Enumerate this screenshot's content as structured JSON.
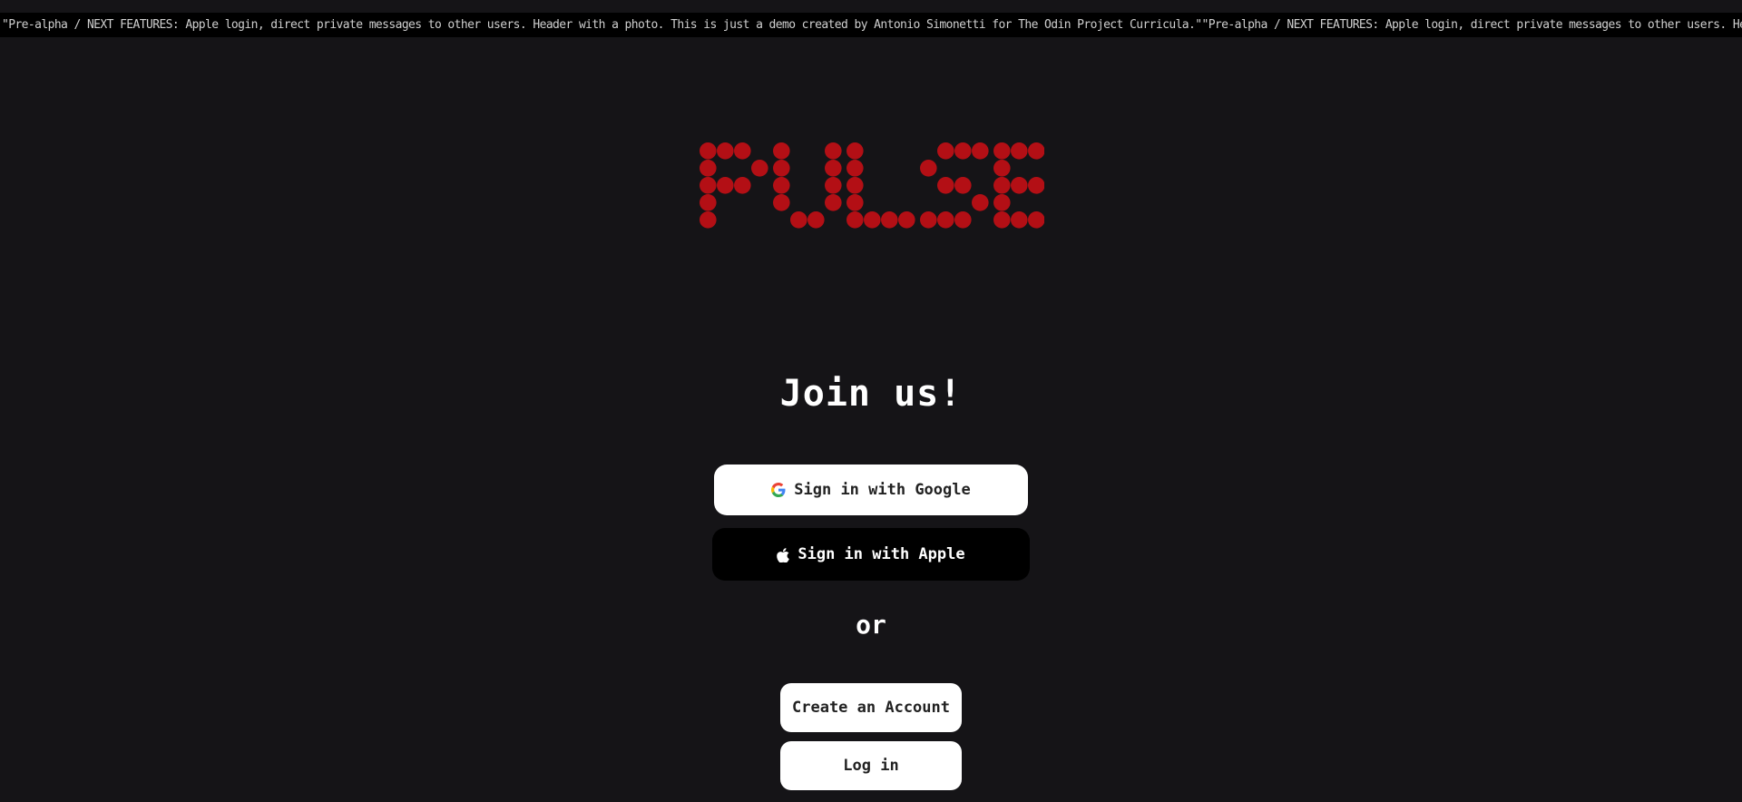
{
  "ticker": {
    "text": "\"Pre-alpha / NEXT FEATURES: Apple login, direct private messages to other users. Header with a photo. This is just a demo created by Antonio Simonetti for The Odin Project Curricula.\"\"Pre-alpha / NEXT FEATURES: Apple login, direct private messages to other users. Header with a photo. This is just a demo created by Antonio Simonetti for The Odin Project Curricula.\""
  },
  "logo": {
    "text": "PULSE",
    "color": "#b30f15"
  },
  "auth": {
    "title": "Join us!",
    "google_label": "Sign in with Google",
    "google_icon": "google-g-icon",
    "apple_label": "Sign in with Apple",
    "apple_icon": "apple-icon",
    "or_label": "or",
    "create_account_label": "Create an Account",
    "login_label": "Log in"
  },
  "colors": {
    "background": "#151417",
    "ticker_background": "#000000",
    "accent_red": "#b30f15",
    "button_light": "#ffffff",
    "button_dark": "#000000"
  }
}
